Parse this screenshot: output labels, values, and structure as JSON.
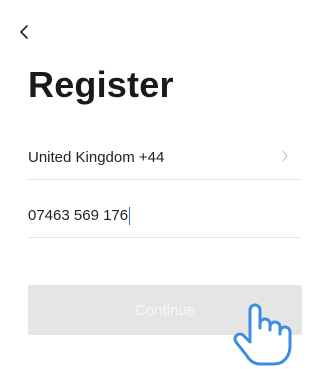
{
  "header": {
    "title": "Register",
    "back_icon": "chevron-left-icon"
  },
  "form": {
    "country": {
      "value": "United Kingdom +44",
      "icon": "chevron-right-icon"
    },
    "phone": {
      "value": "07463 569 176"
    }
  },
  "actions": {
    "continue_label": "Continue",
    "continue_state": "disabled"
  },
  "overlay": {
    "pointer_icon": "hand-pointer-icon"
  },
  "colors": {
    "button_bg": "#e5e5e5",
    "button_text": "#f7f7f7",
    "divider": "#e3e3e3",
    "pointer_outline": "#3b8de0"
  }
}
